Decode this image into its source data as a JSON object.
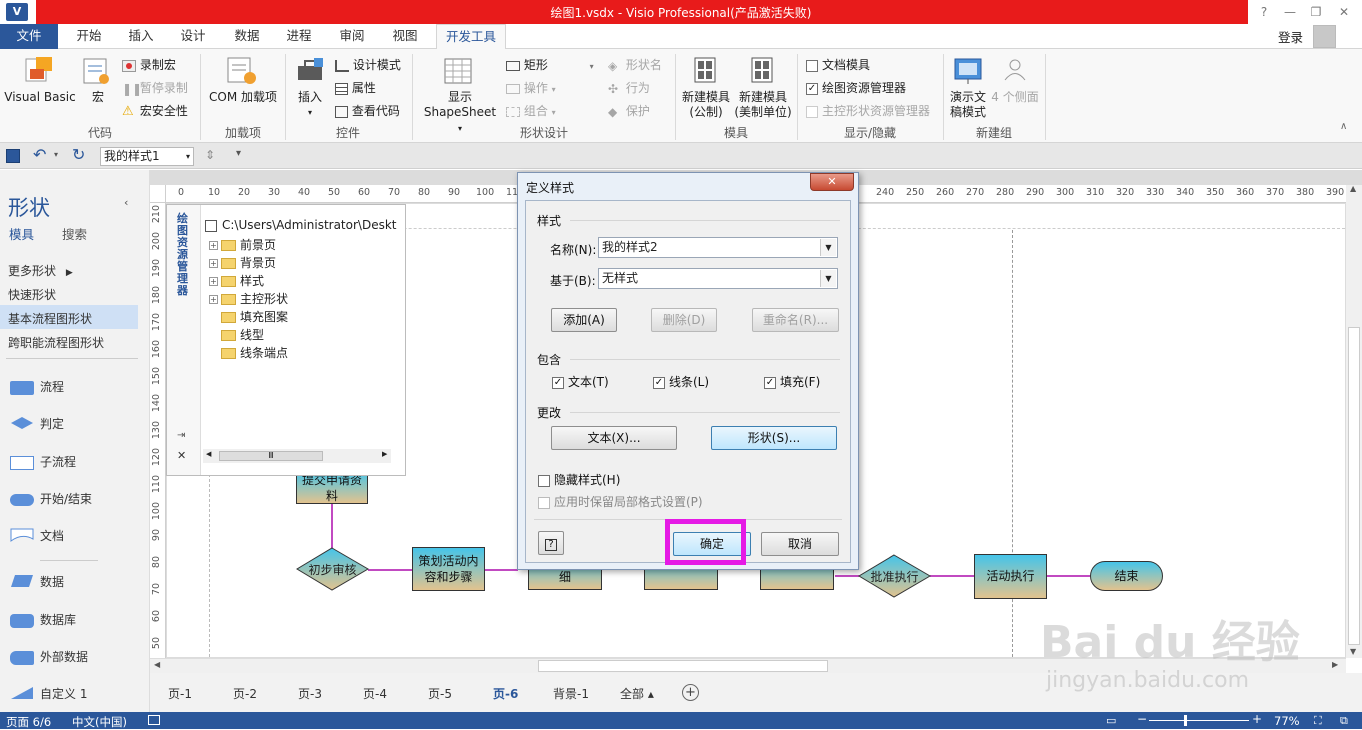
{
  "window": {
    "title": "绘图1.vsdx - Visio Professional(产品激活失败)",
    "help": "?",
    "minimize": "—",
    "restore": "❐",
    "close": "✕"
  },
  "tabs": [
    "文件",
    "开始",
    "插入",
    "设计",
    "数据",
    "进程",
    "审阅",
    "视图",
    "开发工具"
  ],
  "user": {
    "login": "登录"
  },
  "ribbon": {
    "code": {
      "visual_basic": "Visual Basic",
      "macro": "宏",
      "record": "录制宏",
      "pause": "暂停录制",
      "security": "宏安全性",
      "label": "代码"
    },
    "addins": {
      "com": "COM 加载项",
      "label": "加载项"
    },
    "controls": {
      "insert": "插入",
      "design_mode": "设计模式",
      "properties": "属性",
      "view_code": "查看代码",
      "label": "控件"
    },
    "shape_design": {
      "show": "显示",
      "shapesheet": "ShapeSheet",
      "rect": "矩形",
      "operate": "操作",
      "combine": "组合",
      "shape_name": "形状名",
      "behavior": "行为",
      "protect": "保护",
      "label": "形状设计"
    },
    "stencil": {
      "new_metric_1": "新建模具",
      "new_metric_2": "(公制)",
      "new_us_1": "新建模具",
      "new_us_2": "(美制单位)",
      "label": "模具"
    },
    "show_hide": {
      "doc_stencil": "文档模具",
      "explorer": "绘图资源管理器",
      "master_explorer": "主控形状资源管理器",
      "label": "显示/隐藏"
    },
    "new_group": {
      "demo_1": "演示文",
      "demo_2": "稿模式",
      "sides": "4 个侧面",
      "label": "新建组"
    }
  },
  "qat": {
    "style_value": "我的样式1"
  },
  "shapes_panel": {
    "title": "形状",
    "tab_stencils": "模具",
    "tab_search": "搜索",
    "more": "更多形状",
    "quick": "快速形状",
    "basic": "基本流程图形状",
    "cross": "跨职能流程图形状",
    "items": [
      "流程",
      "判定",
      "子流程",
      "开始/结束",
      "文档",
      "数据",
      "数据库",
      "外部数据",
      "自定义 1"
    ]
  },
  "ruler": {
    "h": [
      "0",
      "10",
      "20",
      "30",
      "40",
      "50",
      "60",
      "70",
      "80",
      "90",
      "100",
      "110",
      "240",
      "250",
      "260",
      "270",
      "280",
      "290",
      "300",
      "310",
      "320",
      "330",
      "340",
      "350",
      "360",
      "370",
      "380",
      "390"
    ],
    "v": [
      "210",
      "200",
      "190",
      "180",
      "170",
      "160",
      "150",
      "140",
      "130",
      "120",
      "110",
      "100",
      "90",
      "80",
      "70",
      "60",
      "50"
    ]
  },
  "explorer": {
    "title": "绘图资源管理器",
    "root": "C:\\Users\\Administrator\\Deskt",
    "nodes": [
      "前景页",
      "背景页",
      "样式",
      "主控形状",
      "填充图案",
      "线型",
      "线条端点"
    ],
    "scroll_thumb": "Ⅲ"
  },
  "flow": {
    "p1": "提交申请资料",
    "d1": "初步审核",
    "p2": "策划活动内容和步骤",
    "p3": "细",
    "d2": "批准执行",
    "p4": "活动执行",
    "end": "结束"
  },
  "dialog": {
    "title": "定义样式",
    "style_section": "样式",
    "name_label": "名称(N):",
    "name_value": "我的样式2",
    "based_label": "基于(B):",
    "based_value": "无样式",
    "add": "添加(A)",
    "delete": "删除(D)",
    "rename": "重命名(R)...",
    "include_section": "包含",
    "text_chk": "文本(T)",
    "line_chk": "线条(L)",
    "fill_chk": "填充(F)",
    "change_section": "更改",
    "text_btn": "文本(X)...",
    "shape_btn": "形状(S)...",
    "hidden": "隐藏样式(H)",
    "keep_local": "应用时保留局部格式设置(P)",
    "ok": "确定",
    "cancel": "取消",
    "help": "?"
  },
  "page_tabs": [
    "页-1",
    "页-2",
    "页-3",
    "页-4",
    "页-5",
    "页-6",
    "背景-1",
    "全部 ▴"
  ],
  "status": {
    "page": "页面 6/6",
    "lang": "中文(中国)",
    "zoom": "77%"
  },
  "watermark": {
    "logo": "Bai du 经验",
    "url": "jingyan.baidu.com"
  }
}
